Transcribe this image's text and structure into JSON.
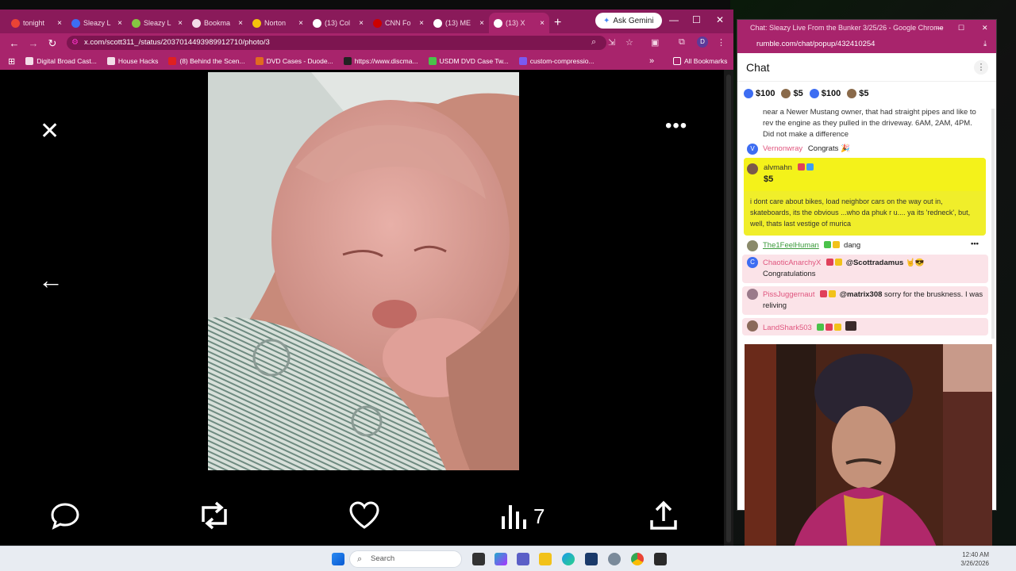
{
  "browser": {
    "tabs": [
      {
        "label": "tonight",
        "icon": "gmail-icon",
        "color": "#ea4335"
      },
      {
        "label": "Sleazy L",
        "icon": "rumble-r-icon",
        "color": "#3d6df2"
      },
      {
        "label": "Sleazy L",
        "icon": "rumble-play-icon",
        "color": "#85c742"
      },
      {
        "label": "Bookma",
        "icon": "star-icon",
        "color": "#f3dce8"
      },
      {
        "label": "Norton",
        "icon": "norton-icon",
        "color": "#f4c20d"
      },
      {
        "label": "(13) Col",
        "icon": "x-logo-icon",
        "color": "#ffffff"
      },
      {
        "label": "CNN Fo",
        "icon": "cnn-icon",
        "color": "#cc0000"
      },
      {
        "label": "(13) ME",
        "icon": "x-logo-icon",
        "color": "#ffffff"
      },
      {
        "label": "(13) X",
        "icon": "x-logo-icon",
        "color": "#ffffff"
      }
    ],
    "new_tab": "+",
    "gemini_label": "Ask Gemini",
    "url": "x.com/scott311_/status/2037014493989912710/photo/3",
    "profile_initial": "D",
    "bookmarks": [
      {
        "label": "Digital Broad Cast...",
        "icon": "folder-icon"
      },
      {
        "label": "House Hacks",
        "icon": "folder-icon"
      },
      {
        "label": "(8) Behind the Scen...",
        "icon": "youtube-icon"
      },
      {
        "label": "DVD Cases - Duode...",
        "icon": "duode-icon"
      },
      {
        "label": "https://www.discma...",
        "icon": "discmakers-icon"
      },
      {
        "label": "USDM DVD Case Tw...",
        "icon": "usdm-icon"
      },
      {
        "label": "custom-compressio...",
        "icon": "compression-icon"
      }
    ],
    "more_bookmarks": "»",
    "all_bookmarks": "All Bookmarks"
  },
  "photo_viewer": {
    "views_count": "7"
  },
  "chat_window": {
    "title": "Chat: Sleazy Live From the Bunker 3/25/26 - Google Chrome",
    "url": "rumble.com/chat/popup/432410254",
    "header": "Chat",
    "rants": [
      {
        "amount": "$100",
        "color": "#3d6df2"
      },
      {
        "amount": "$5",
        "color": "#8a6a4a"
      },
      {
        "amount": "$100",
        "color": "#3d6df2"
      },
      {
        "amount": "$5",
        "color": "#8a6a4a"
      }
    ],
    "messages": [
      {
        "text": "near a Newer Mustang owner, that had straight pipes and like to rev the engine as they pulled in the driveway. 6AM, 2AM, 4PM. Did not make a difference"
      },
      {
        "user": "Vernonwray",
        "text": "Congrats 🎉",
        "user_color": "#e0557e"
      },
      {
        "user": "alvmahn",
        "amount": "$5",
        "text": "i dont care about bikes, load neighbor cars on the way out in, skateboards, its the obvious ...who da phuk r u.... ya its 'redneck', but, well, thats last vestige of murica"
      },
      {
        "user": "The1FeelHuman",
        "text": "dang",
        "user_color": "#3a9a3a"
      },
      {
        "user": "ChaoticAnarchyX",
        "mention": "@Scottradamus",
        "text": "Congratulations",
        "user_color": "#e0557e"
      },
      {
        "user": "PissJuggernaut",
        "mention": "@matrix308",
        "text": "sorry for the bruskness. I was reliving",
        "user_color": "#e0557e"
      },
      {
        "user": "LandShark503",
        "text": "",
        "user_color": "#e0557e"
      }
    ]
  },
  "taskbar": {
    "search_placeholder": "Search",
    "time": "12:40 AM",
    "date": "3/26/2026"
  }
}
